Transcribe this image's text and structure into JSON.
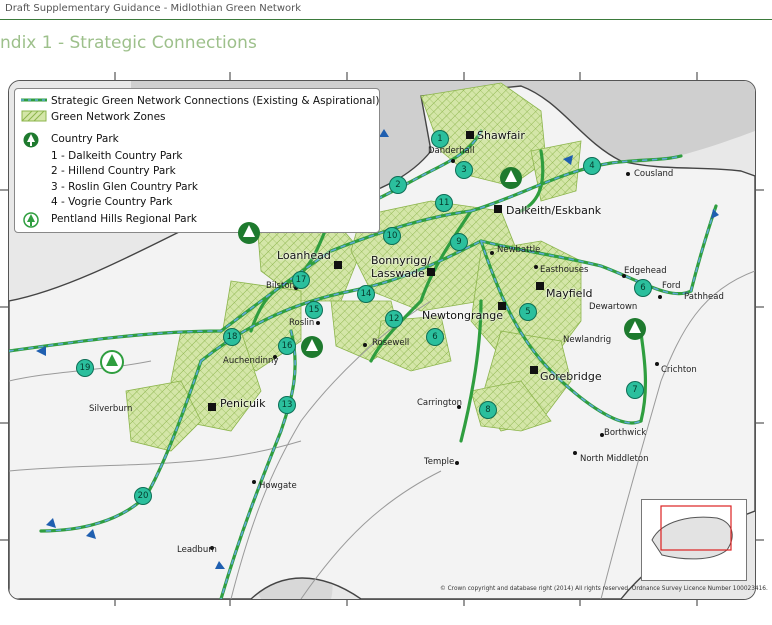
{
  "header": {
    "title": "Draft Supplementary Guidance - Midlothian Green Network"
  },
  "section_title": "ndix 1 - Strategic Connections",
  "legend": {
    "routes": "Strategic Green Network Connections (Existing & Aspirational)",
    "zones": "Green Network Zones",
    "country_park": "Country Park",
    "park_1": "1 - Dalkeith Country Park",
    "park_2": "2 - Hillend Country Park",
    "park_3": "3 - Roslin Glen Country Park",
    "park_4": "4 - Vogrie Country Park",
    "regional_park": "Pentland Hills Regional Park"
  },
  "towns": {
    "shawfair": "Shawfair",
    "dalkeith": "Dalkeith/Eskbank",
    "loanhead": "Loanhead",
    "bonnyrigg": "Bonnyrigg/",
    "lasswade": "Lasswade",
    "newtongrange": "Newtongrange",
    "mayfield": "Mayfield",
    "gorebridge": "Gorebridge",
    "penicuik": "Penicuik"
  },
  "places": {
    "danderhall": "Danderhall",
    "cousland": "Cousland",
    "newbattle": "Newbattle",
    "easthouses": "Easthouses",
    "edgehead": "Edgehead",
    "ford": "Ford",
    "pathhead": "Pathhead",
    "dewartown": "Dewartown",
    "newlandrig": "Newlandrig",
    "bilston": "Bilston",
    "roslin": "Roslin",
    "rosewell": "Rosewell",
    "auchendinny": "Auchendinny",
    "silverburn": "Silverburn",
    "carrington": "Carrington",
    "crichton": "Crichton",
    "borthwick": "Borthwick",
    "north_middleton": "North Middleton",
    "temple": "Temple",
    "howgate": "Howgate",
    "leadburn": "Leadburn"
  },
  "connections": [
    "1",
    "2",
    "3",
    "4",
    "5",
    "6",
    "7",
    "8",
    "9",
    "10",
    "11",
    "12",
    "13",
    "14",
    "15",
    "16",
    "17",
    "18",
    "19",
    "20"
  ],
  "copyright": "© Crown copyright and database right (2014) All rights reserved. Ordnance Survey Licence Number 100023416."
}
